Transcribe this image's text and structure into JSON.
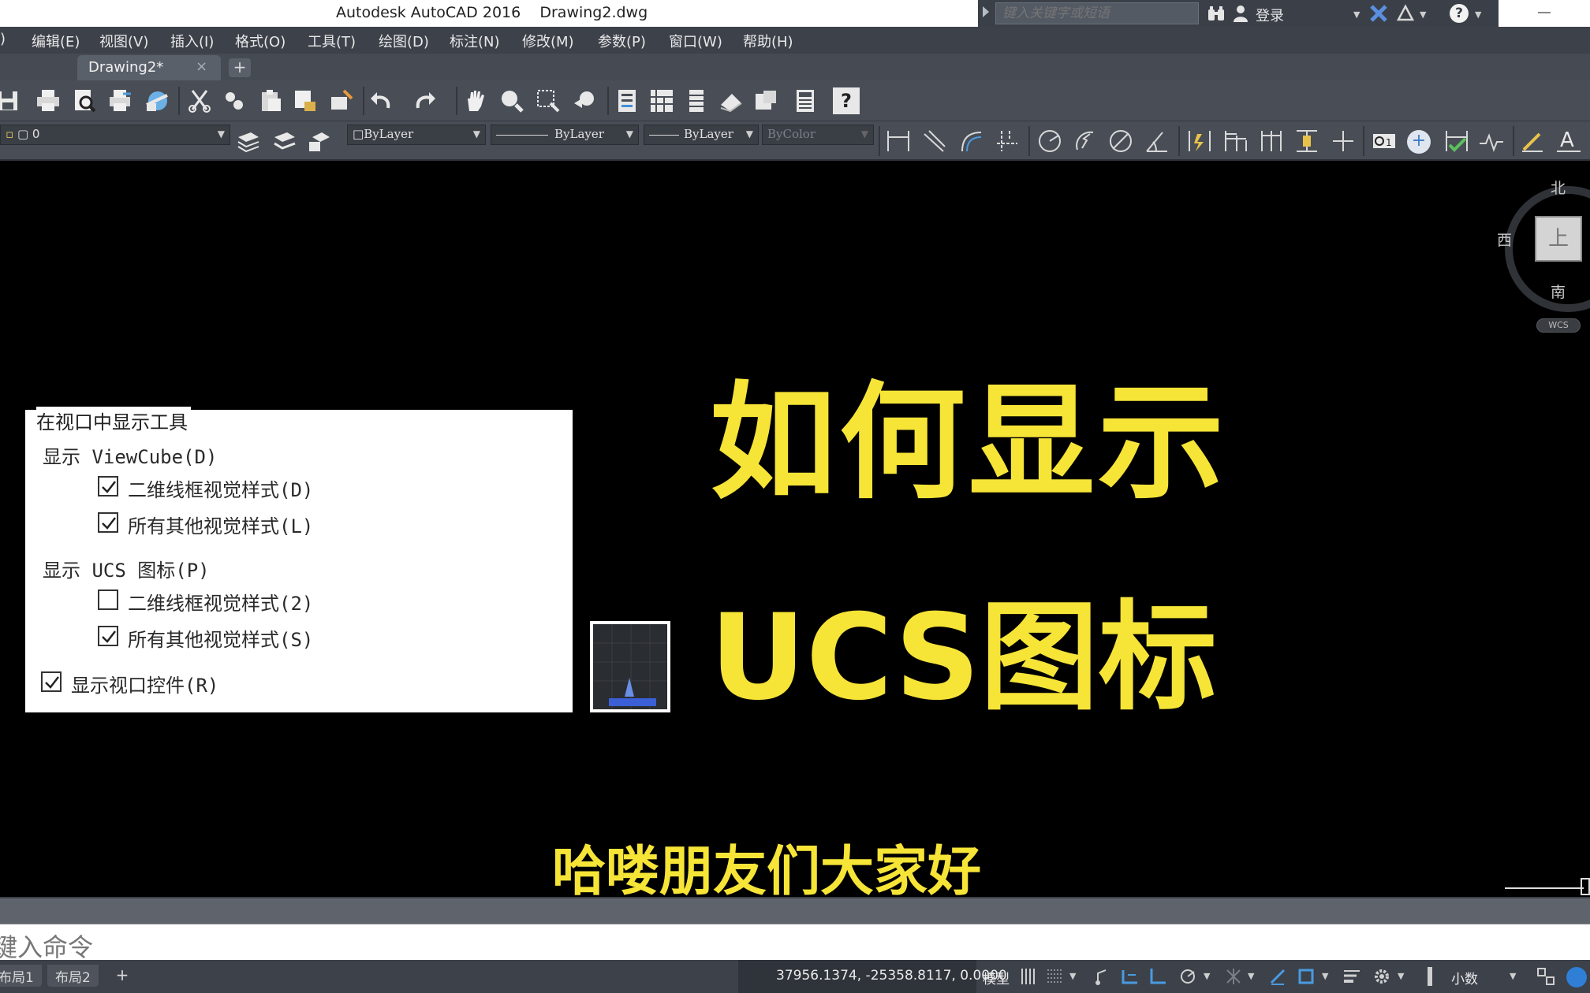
{
  "titlebar": {
    "title": "Autodesk AutoCAD 2016    Drawing2.dwg",
    "search_placeholder": "键入关键字或短语",
    "login": "登录"
  },
  "menu": [
    "编辑(E)",
    "视图(V)",
    "插入(I)",
    "格式(O)",
    "工具(T)",
    "绘图(D)",
    "标注(N)",
    "修改(M)",
    "参数(P)",
    "窗口(W)",
    "帮助(H)"
  ],
  "menu_partial": ")",
  "tabs": {
    "file_tab": "Drawing2*",
    "close": "×",
    "new_tab": "+"
  },
  "toolbar2": {
    "layer": "0",
    "color": "ByLayer",
    "linetype": "ByLayer",
    "lineweight": "ByLayer",
    "plotstyle": "ByColor"
  },
  "viewcube": {
    "north": "北",
    "west": "西",
    "south": "南",
    "face": "上",
    "wcs": "WCS"
  },
  "dialog": {
    "heading": "在视口中显示工具",
    "viewcube_group": "显示 ViewCube(D)",
    "viewcube_2d": {
      "label": "二维线框视觉样式(D)",
      "checked": true
    },
    "viewcube_all": {
      "label": "所有其他视觉样式(L)",
      "checked": true
    },
    "ucs_group": "显示 UCS 图标(P)",
    "ucs_2d": {
      "label": "二维线框视觉样式(2)",
      "checked": false
    },
    "ucs_all": {
      "label": "所有其他视觉样式(S)",
      "checked": true
    },
    "viewport_controls": {
      "label": "显示视口控件(R)",
      "checked": true
    }
  },
  "captions": {
    "headline_1": "如何显示",
    "headline_2": "UCS图标",
    "subtitle": "哈喽朋友们大家好"
  },
  "command": {
    "placeholder": "键入命令"
  },
  "statusbar": {
    "layout1": "布局1",
    "layout2": "布局2",
    "add": "+",
    "coords": "37956.1374, -25358.8117, 0.0000",
    "model": "模型",
    "units": "小数"
  },
  "colors": {
    "caption": "#f6e437",
    "canvas": "#000000",
    "chrome": "#3c414a"
  }
}
